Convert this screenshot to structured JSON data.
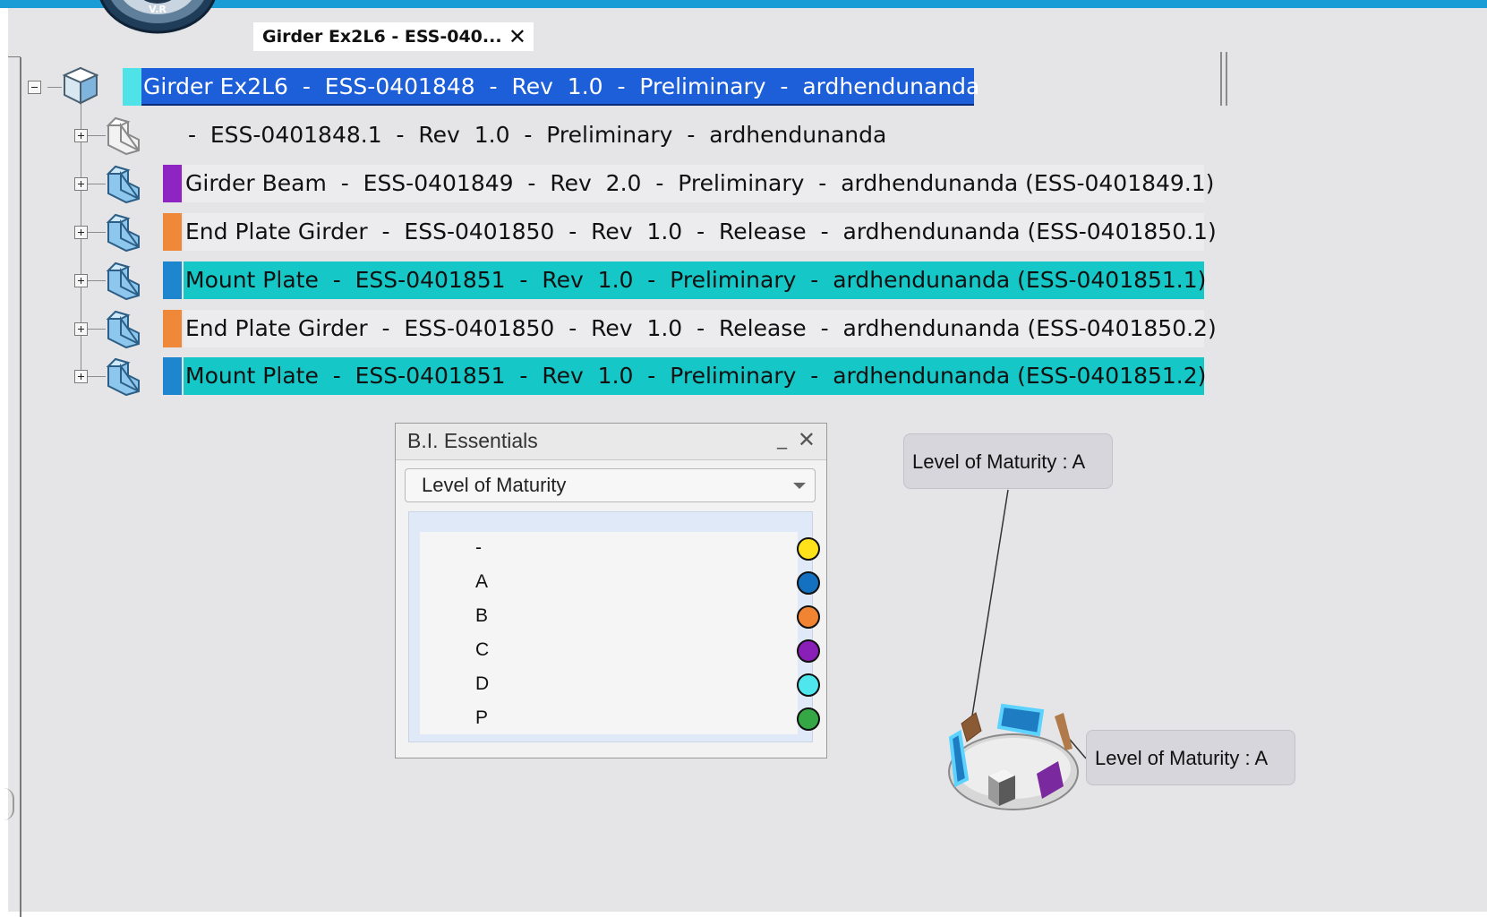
{
  "document_tab": {
    "title": "Girder Ex2L6  -  ESS-040...",
    "close": "✕"
  },
  "tree": {
    "root": {
      "label": "Girder Ex2L6  -  ESS-0401848  -  Rev  1.0  -  Preliminary  -  ardhendunanda",
      "tag_color": "#4fe3e8"
    },
    "children": [
      {
        "label": " -  ESS-0401848.1  -  Rev  1.0  -  Preliminary  -  ardhendunanda",
        "tag_color": ""
      },
      {
        "label": "Girder Beam  -  ESS-0401849  -  Rev  2.0  -  Preliminary  -  ardhendunanda (ESS-0401849.1)",
        "tag_color": "#8e24c2"
      },
      {
        "label": "End Plate Girder  -  ESS-0401850  -  Rev  1.0  -  Release  -  ardhendunanda (ESS-0401850.1)",
        "tag_color": "#f0883a"
      },
      {
        "label": "Mount Plate  -  ESS-0401851  -  Rev  1.0  -  Preliminary  -  ardhendunanda (ESS-0401851.1)",
        "tag_color": "#1d86cf"
      },
      {
        "label": "End Plate Girder  -  ESS-0401850  -  Rev  1.0  -  Release  -  ardhendunanda (ESS-0401850.2)",
        "tag_color": "#f0883a"
      },
      {
        "label": "Mount Plate  -  ESS-0401851  -  Rev  1.0  -  Preliminary  -  ardhendunanda (ESS-0401851.2)",
        "tag_color": "#1d86cf"
      }
    ]
  },
  "bi_panel": {
    "title": "B.I. Essentials",
    "minimize": "_",
    "close": "✕",
    "dropdown_value": "Level of Maturity",
    "legend": [
      {
        "label": "-",
        "color": "#ffe21a"
      },
      {
        "label": "A",
        "color": "#1470c0"
      },
      {
        "label": "B",
        "color": "#f08433"
      },
      {
        "label": "C",
        "color": "#8a1fb8"
      },
      {
        "label": "D",
        "color": "#4fe6ee"
      },
      {
        "label": "P",
        "color": "#35a845"
      }
    ]
  },
  "callouts": [
    {
      "text": "Level of Maturity : A"
    },
    {
      "text": "Level of Maturity : A"
    }
  ],
  "compass_label": "V.R"
}
